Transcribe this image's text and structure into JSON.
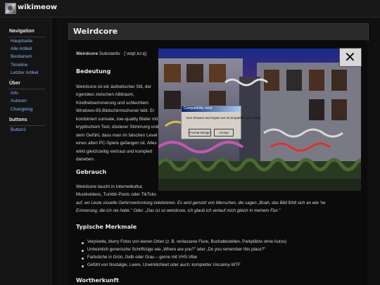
{
  "site": {
    "name": "wikimeow"
  },
  "sidebar": {
    "sections": [
      {
        "title": "Navigation",
        "items": [
          "Hauptseite",
          "Alle Artikel",
          "Bestiarium",
          "Timeline",
          "Letzter Artikel"
        ]
      },
      {
        "title": "Über",
        "items": [
          "Info",
          "Autoren",
          "Changelog"
        ]
      },
      {
        "title": "buttons",
        "items": [
          "Button1"
        ]
      }
    ]
  },
  "page": {
    "title": "Weirdcore",
    "intro": {
      "term": "Weirdcore",
      "rest": " Substantiv · [ˈwɪɐ̯tˌkɔːɐ̯]"
    },
    "sections": {
      "bedeutung": {
        "heading": "Bedeutung",
        "lines": [
          "Weirdcore ist ein ästhetischer Stil, der",
          "irgendwo zwischen Albtraum,",
          "Kindheitserinnerung und schlechtem",
          "Windows-95-Bildschirmschoner lebt. Er",
          "kombiniert surreale, low-quality Bilder mit",
          "kryptischem Text, düsterer Stimmung und",
          "dem Gefühl, dass man im falschen Level",
          "eines alten PC-Spiels gefangen ist. Alles",
          "wirkt gleichzeitig vertraut und komplett",
          "daneben."
        ]
      },
      "gebrauch": {
        "heading": "Gebrauch",
        "lines": [
          "Weirdcore taucht in Internetkultur,",
          "Musikvideos, Tumblr-Posts oder TikToks",
          "auf, wo Leute visuelle Gehirnverknotung zelebrieren. Es wird genutzt von Menschen, die sagen „Boah, das Bild fühlt sich an wie 'ne",
          "Erinnerung, die ich nie hatte.\" Oder: „Das ist so weirdcore, ich glaub ich verlauf mich gleich in meinem Flur.\""
        ]
      },
      "merkmale": {
        "heading": "Typische Merkmale",
        "items": [
          "Verpixelte, blurry Fotos von leeren Orten (z. B. verlassene Flure, Bushaltestellen, Parkplätze ohne Autos)",
          "Unheimlich generische Schriftzüge wie „Where are you?\" oder „Do you remember this place?\"",
          "Farbstiche in Grün, Gelb oder Grau – gerne mit VHS-Vibe",
          "Gefühl von Nostalgie, Leere, Unwirklichkeit oder auch: kompletter Uncanny-WTF"
        ]
      },
      "wortherkunft": {
        "heading": "Wortherkunft"
      }
    },
    "image": {
      "dialog": {
        "title": "Compatibility error",
        "message": "Your dreams and hopes are incompatible with reality.",
        "buttons": [
          "Format Design",
          "Accept"
        ]
      },
      "close_glyph": "✕"
    }
  }
}
